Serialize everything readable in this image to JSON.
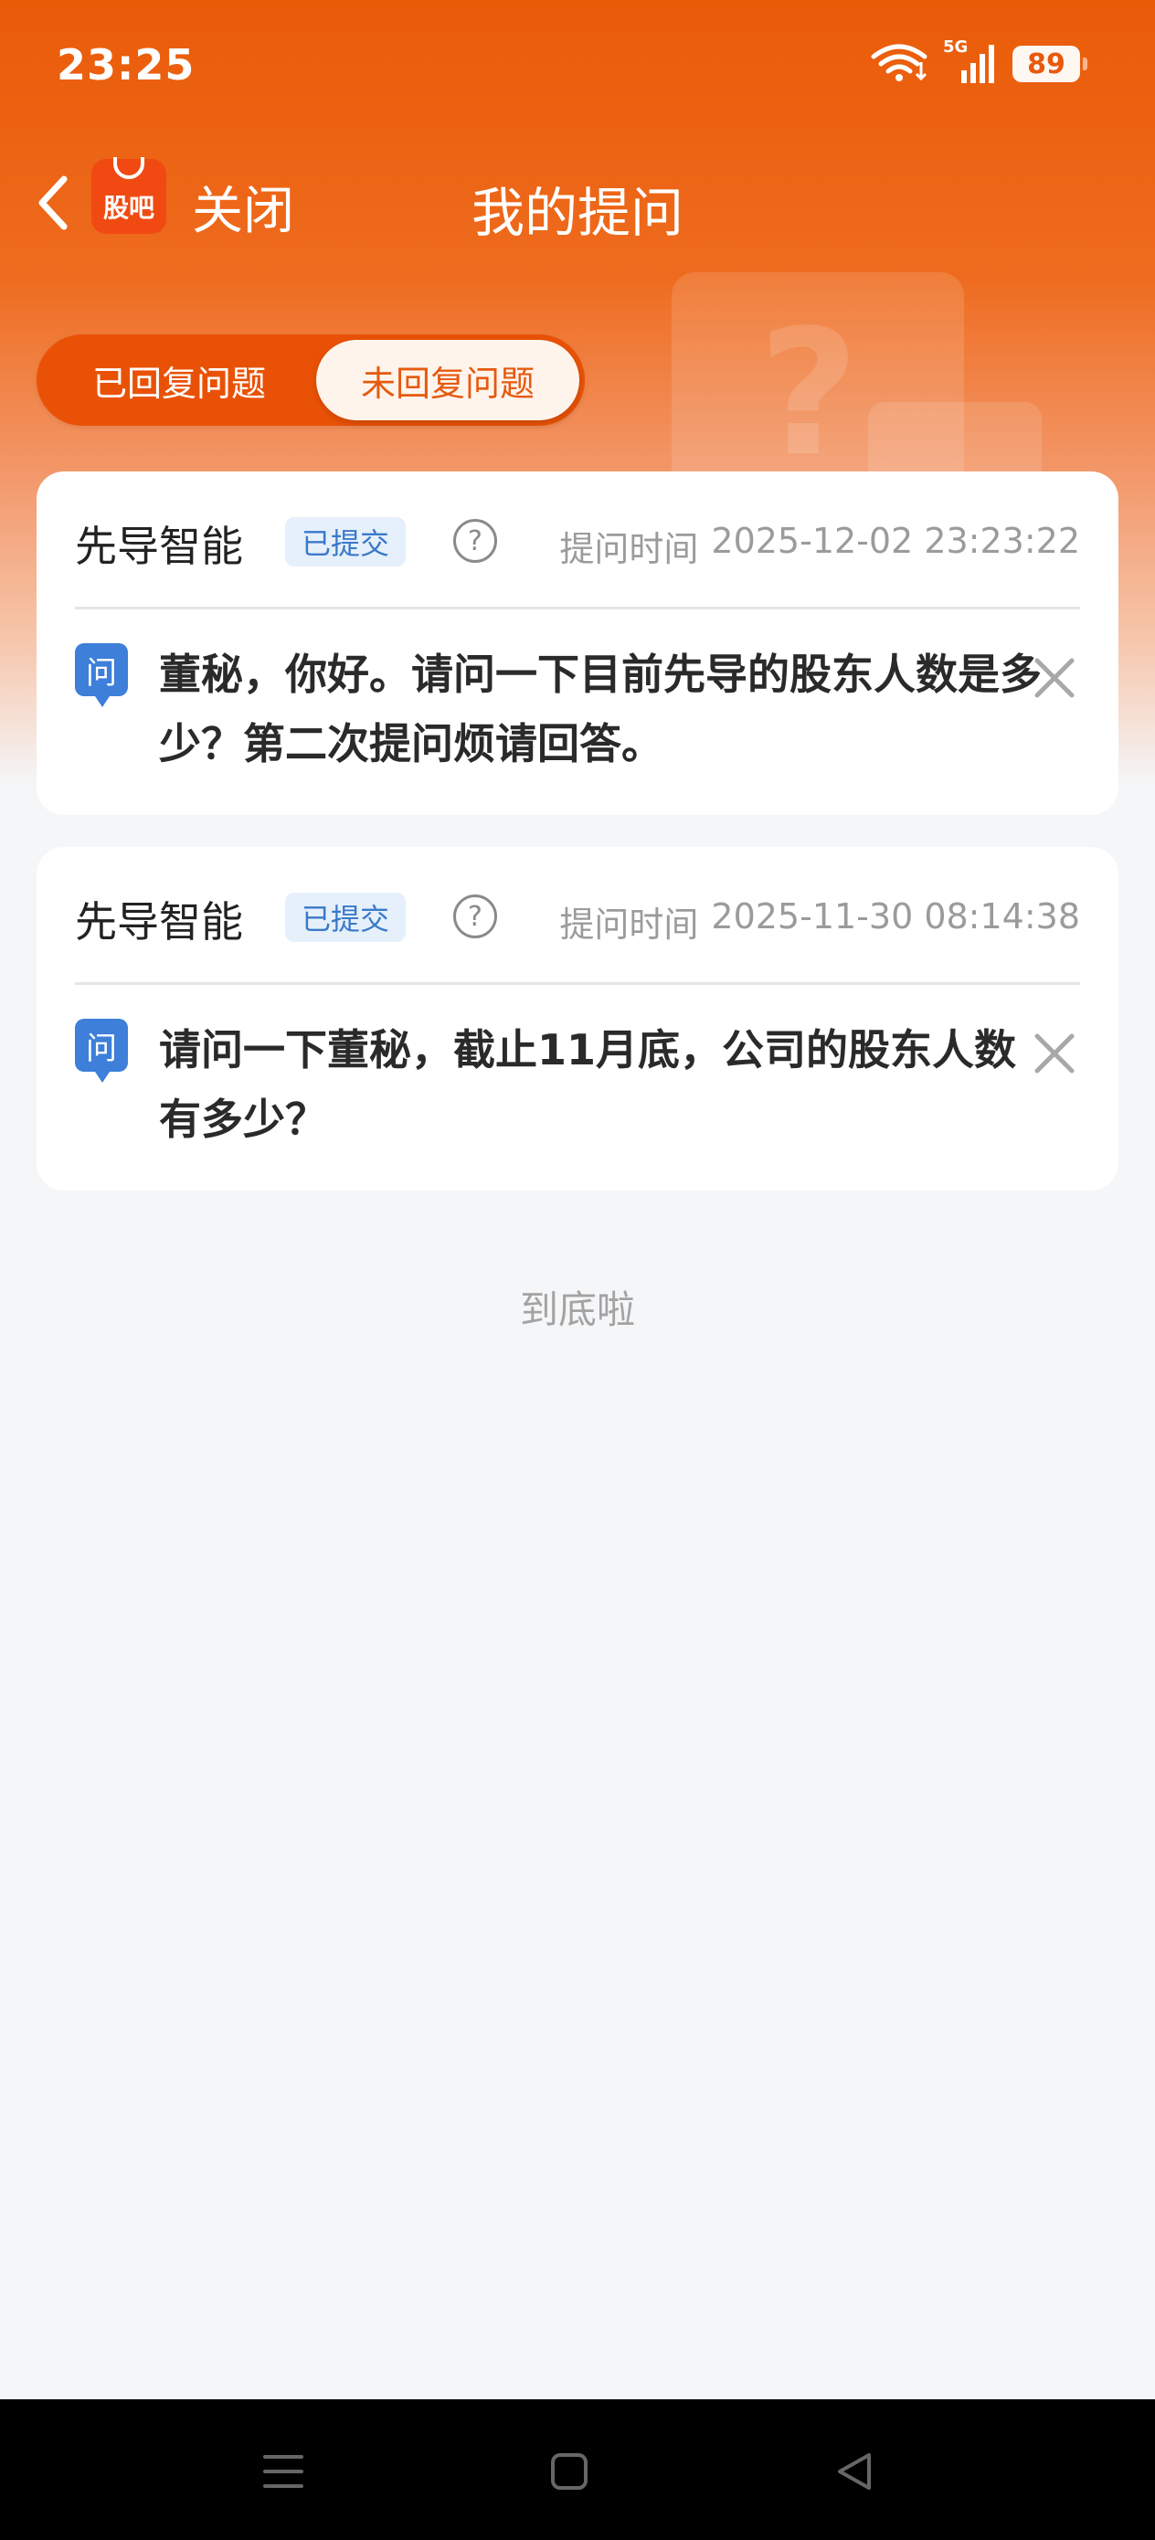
{
  "status_bar": {
    "time": "23:25",
    "network": "5G",
    "battery": "89"
  },
  "nav": {
    "logo_text": "股吧",
    "close_label": "关闭",
    "title": "我的提问"
  },
  "tabs": {
    "answered_label": "已回复问题",
    "unanswered_label": "未回复问题",
    "active": "unanswered"
  },
  "questions": [
    {
      "company": "先导智能",
      "status": "已提交",
      "time_label": "提问时间",
      "time": "2025-12-02 23:23:22",
      "q_badge": "问",
      "text": "董秘，你好。请问一下目前先导的股东人数是多少？第二次提问烦请回答。"
    },
    {
      "company": "先导智能",
      "status": "已提交",
      "time_label": "提问时间",
      "time": "2025-11-30 08:14:38",
      "q_badge": "问",
      "text": "请问一下董秘，截止11月底，公司的股东人数有多少？"
    }
  ],
  "footer": {
    "end_text": "到底啦"
  },
  "colors": {
    "brand_orange": "#ea5b08",
    "badge_blue": "#3d7fd9"
  }
}
